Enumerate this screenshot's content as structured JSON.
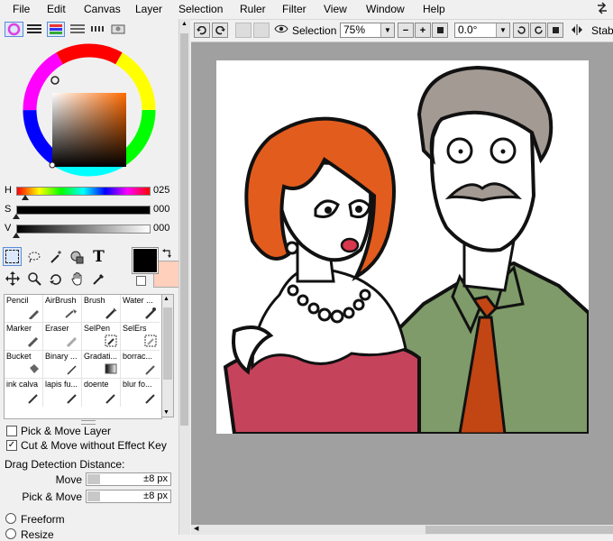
{
  "menu": [
    "File",
    "Edit",
    "Canvas",
    "Layer",
    "Selection",
    "Ruler",
    "Filter",
    "View",
    "Window",
    "Help"
  ],
  "toolbar": {
    "selection_label": "Selection",
    "zoom": "75%",
    "rotation": "0.0°",
    "stab_label": "Stab"
  },
  "color": {
    "h_label": "H",
    "h_value": "025",
    "s_label": "S",
    "s_value": "000",
    "v_label": "V",
    "v_value": "000",
    "foreground": "#000000",
    "background": "#ffd0bc"
  },
  "brushes": [
    {
      "label": "Pencil"
    },
    {
      "label": "AirBrush"
    },
    {
      "label": "Brush"
    },
    {
      "label": "Water ..."
    },
    {
      "label": "Marker"
    },
    {
      "label": "Eraser"
    },
    {
      "label": "SelPen"
    },
    {
      "label": "SelErs"
    },
    {
      "label": "Bucket"
    },
    {
      "label": "Binary ..."
    },
    {
      "label": "Gradati..."
    },
    {
      "label": "borrac..."
    },
    {
      "label": "ink calva"
    },
    {
      "label": "lapis fu..."
    },
    {
      "label": "doente"
    },
    {
      "label": "blur fo..."
    }
  ],
  "options": {
    "pick_move_layer": "Pick & Move Layer",
    "cut_move": "Cut & Move without Effect Key",
    "drag_distance": "Drag Detection Distance:",
    "move_label": "Move",
    "move_value": "±8 px",
    "pick_move_label": "Pick & Move",
    "pick_move_value": "±8 px",
    "freeform": "Freeform",
    "resize": "Resize"
  }
}
